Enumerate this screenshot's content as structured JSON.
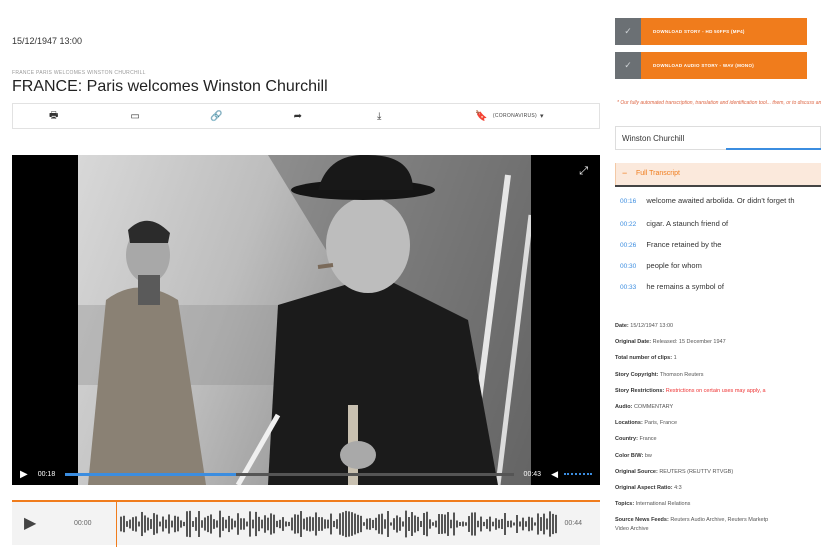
{
  "header": {
    "datetime": "15/12/1947 13:00",
    "kicker": "FRANCE PARIS WELCOMES WINSTON CHURCHILL",
    "title": "FRANCE: Paris welcomes Winston Churchill"
  },
  "toolbar": {
    "bookmark_label": "(CORONAVIRUS)"
  },
  "player": {
    "current_time": "00:18",
    "duration": "00:43",
    "progress": 0.38
  },
  "audio": {
    "start": "00:00",
    "end": "00:44"
  },
  "downloads": {
    "story_label": "DOWNLOAD STORY - HD 50FPS (MP4)",
    "audio_label": "DOWNLOAD AUDIO STORY - WAV (MONO)"
  },
  "notice": {
    "text": "* Our fully automated transcription, translation and identification tool... them, or to discuss any questions or concerns, please visit here"
  },
  "speaker": {
    "name": "Winston Churchill"
  },
  "transcript": {
    "label": "Full Transcript",
    "lines": [
      {
        "time": "00:16",
        "text": "welcome awaited arbolida. Or didn't forget th"
      },
      {
        "time": "00:22",
        "text": "cigar. A staunch friend of"
      },
      {
        "time": "00:26",
        "text": "France retained by the"
      },
      {
        "time": "00:30",
        "text": "people for whom"
      },
      {
        "time": "00:33",
        "text": "he remains a symbol of"
      }
    ]
  },
  "metadata": [
    {
      "label": "Date:",
      "value": "15/12/1947 13:00"
    },
    {
      "label": "Original Date:",
      "value": "Released: 15 December 1947"
    },
    {
      "label": "Total number of clips:",
      "value": "1"
    },
    {
      "label": "Story Copyright:",
      "value": "Thomson Reuters"
    },
    {
      "label": "Story Restrictions:",
      "value": "Restrictions on certain uses may apply, a"
    },
    {
      "label": "Audio:",
      "value": "COMMENTARY"
    },
    {
      "label": "Locations:",
      "value": "Paris, France"
    },
    {
      "label": "Country:",
      "value": "France"
    },
    {
      "label": "Color B/W:",
      "value": "bw"
    },
    {
      "label": "Original Source:",
      "value": "REUTERS (REUTTV RTVGB)"
    },
    {
      "label": "Original Aspect Ratio:",
      "value": "4:3"
    },
    {
      "label": "Topics:",
      "value": "International Relations"
    },
    {
      "label": "Source News Feeds:",
      "value": "Reuters Audio Archive, Reuters Marketp"
    },
    {
      "label": "",
      "value": "Video Archive"
    }
  ],
  "colors": {
    "accent": "#f07c1c",
    "link": "#3b8de0",
    "restriction": "#e33333"
  }
}
